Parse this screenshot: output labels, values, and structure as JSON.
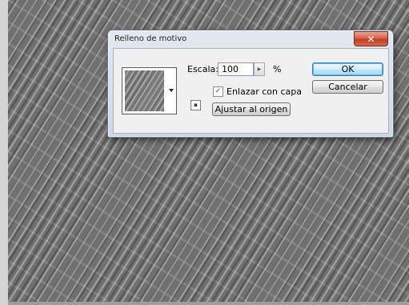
{
  "dialog": {
    "title": "Relleno de motivo",
    "close_glyph": "✕"
  },
  "scale": {
    "label": "Escala:",
    "value": "100",
    "unit": "%"
  },
  "link_layer": {
    "label": "Enlazar con capa",
    "checked": true,
    "check_glyph": "✓"
  },
  "buttons": {
    "snap_origin": "Ajustar al origen",
    "ok": "OK",
    "cancel": "Cancelar"
  },
  "icons": {
    "close": "close-icon",
    "picker_arrow": "chevron-down-icon",
    "spin_arrow": "chevron-right-icon",
    "create_preset": "new-preset-icon"
  },
  "colors": {
    "close_button": "#c03c26",
    "ok_border": "#3c7fb1",
    "canvas": "#7a7a7a"
  }
}
